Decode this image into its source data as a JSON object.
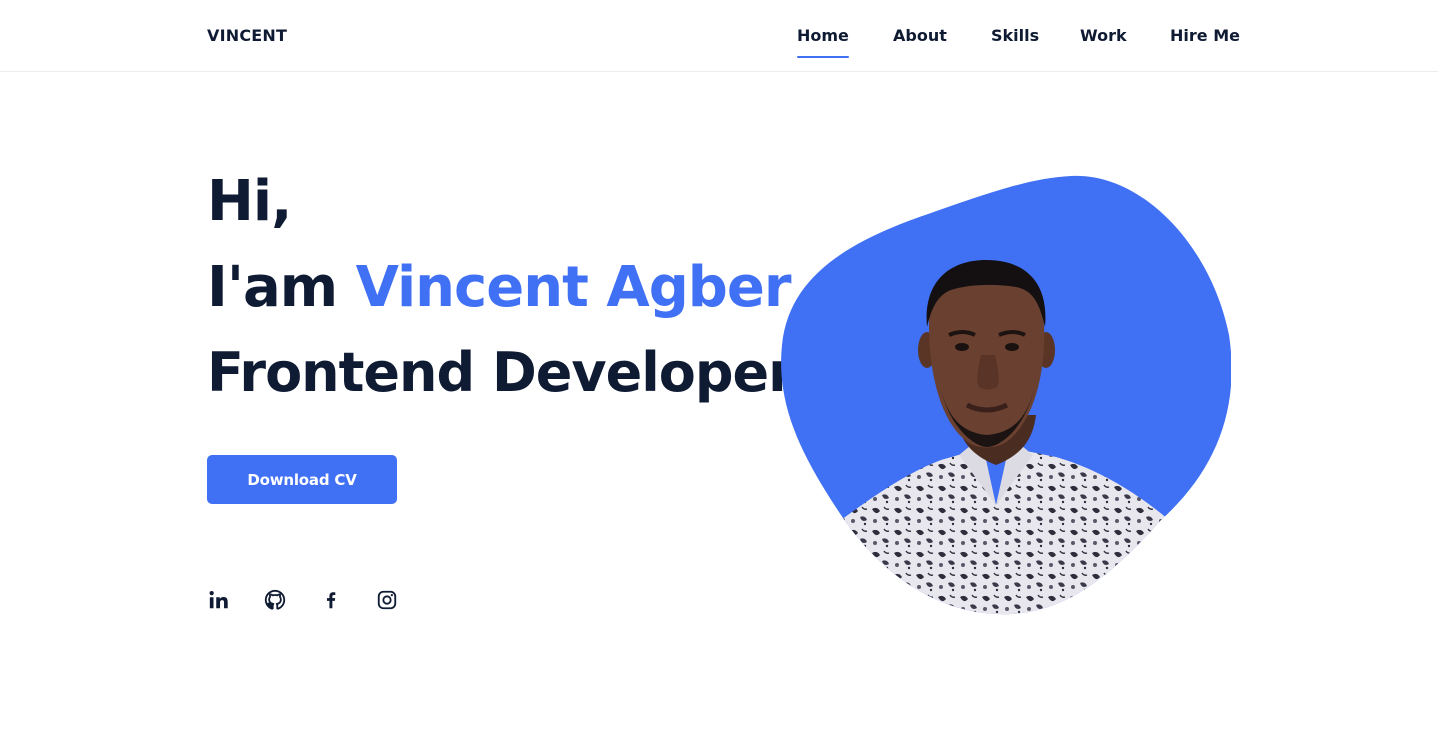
{
  "header": {
    "logo": "VINCENT",
    "nav": [
      {
        "label": "Home",
        "active": true
      },
      {
        "label": "About",
        "active": false
      },
      {
        "label": "Skills",
        "active": false
      },
      {
        "label": "Work",
        "active": false
      },
      {
        "label": "Hire Me",
        "active": false
      }
    ]
  },
  "hero": {
    "greeting": "Hi,",
    "intro_prefix": "I'am ",
    "name": "Vincent Agber",
    "role": "Frontend Developer",
    "cta_label": "Download CV"
  },
  "social": [
    {
      "icon": "linkedin-icon"
    },
    {
      "icon": "github-icon"
    },
    {
      "icon": "facebook-icon"
    },
    {
      "icon": "instagram-icon"
    }
  ],
  "colors": {
    "accent": "#4070f4",
    "text": "#0f1a33"
  }
}
